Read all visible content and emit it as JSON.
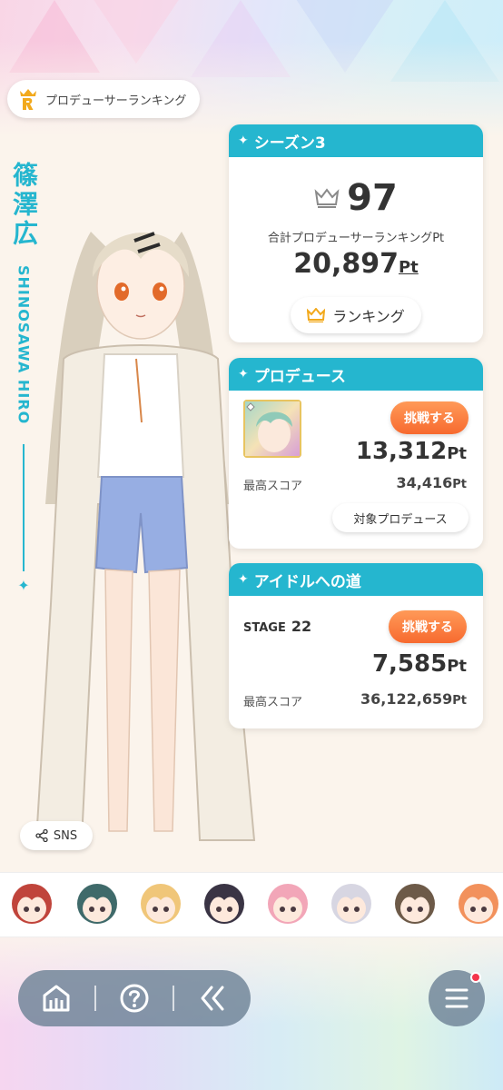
{
  "ranking_pill": {
    "label": "プロデューサーランキング",
    "icon": "ranking-r-crown-icon"
  },
  "character": {
    "name_kanji": "篠澤広",
    "name_roman": "SHINOSAWA HIRO"
  },
  "season_card": {
    "title": "シーズン3",
    "rank": "97",
    "total_label": "合計プロデューサーランキングPt",
    "total_value": "20,897",
    "unit": "Pt",
    "ranking_button": "ランキング"
  },
  "produce_card": {
    "title": "プロデュース",
    "challenge_button": "挑戦する",
    "score": "13,312",
    "unit": "Pt",
    "best_label": "最高スコア",
    "best_value": "34,416",
    "target_button": "対象プロデュース"
  },
  "road_card": {
    "title": "アイドルへの道",
    "stage_label": "STAGE",
    "stage_num": "22",
    "challenge_button": "挑戦する",
    "score": "7,585",
    "unit": "Pt",
    "best_label": "最高スコア",
    "best_value": "36,122,659"
  },
  "sns_button": "SNS",
  "colors": {
    "accent": "#25b6cf",
    "challenge": "#f76a2f",
    "nav": "#6e8296",
    "badge": "#f4364c"
  },
  "idols": [
    {
      "icon": "idol-red-hair-icon",
      "hair": "#c0443b"
    },
    {
      "icon": "idol-teal-hair-icon",
      "hair": "#3f6a6a"
    },
    {
      "icon": "idol-blonde-hair-icon",
      "hair": "#f0c679"
    },
    {
      "icon": "idol-dark-hair-icon",
      "hair": "#3a3444"
    },
    {
      "icon": "idol-pink-hair-icon",
      "hair": "#f2a6b8"
    },
    {
      "icon": "idol-silver-hair-icon",
      "hair": "#d7d6e2"
    },
    {
      "icon": "idol-brown-hair-icon",
      "hair": "#6d5a48"
    },
    {
      "icon": "idol-orange-hair-icon",
      "hair": "#f2915c"
    }
  ],
  "nav": [
    "home-icon",
    "help-icon",
    "back-icon",
    "menu-icon"
  ]
}
